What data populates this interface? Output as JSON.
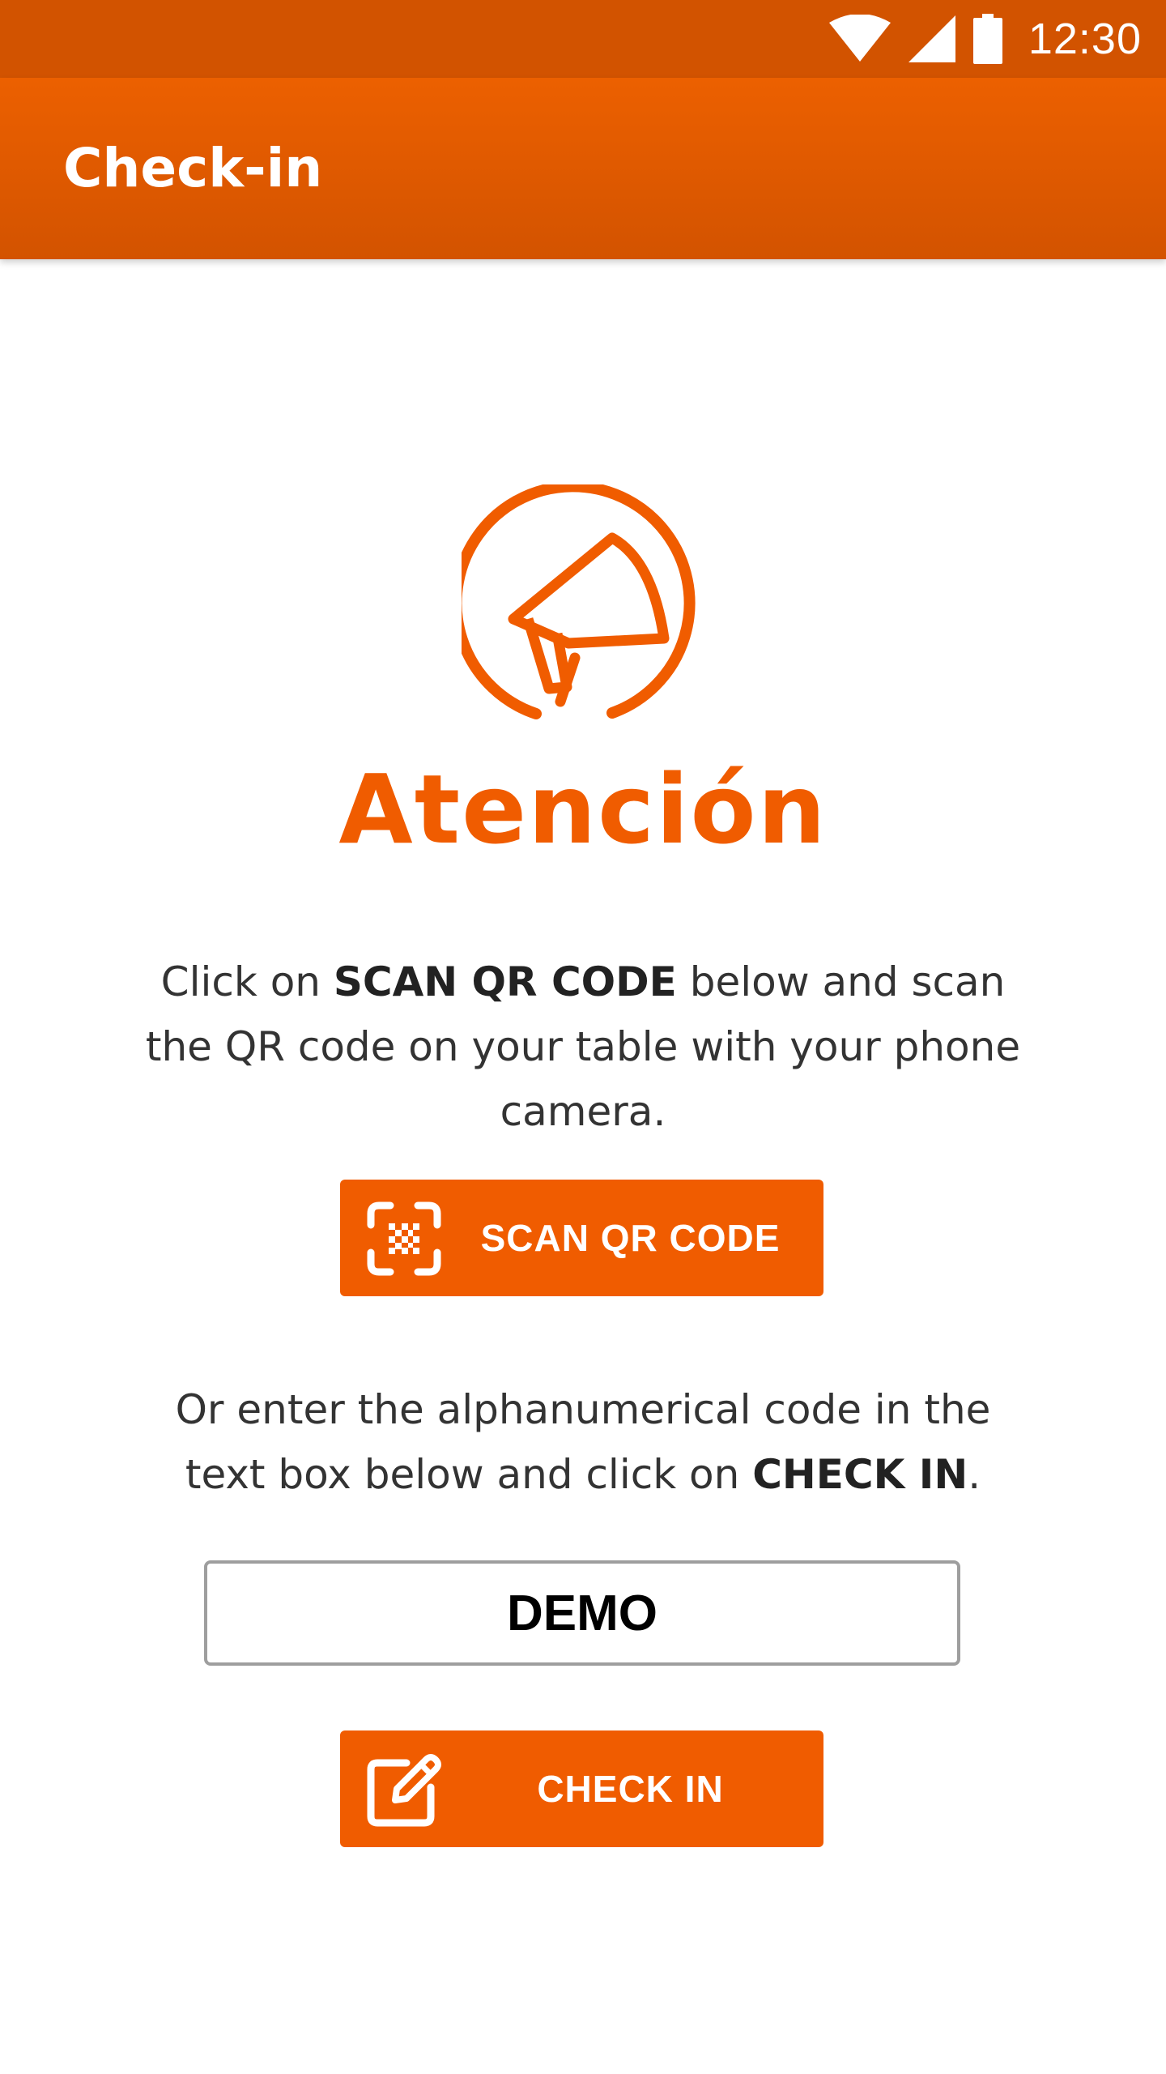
{
  "status_bar": {
    "time": "12:30",
    "icons": [
      "wifi-icon",
      "cell-signal-icon",
      "battery-icon"
    ]
  },
  "app_bar": {
    "title": "Check-in"
  },
  "brand": {
    "name": "Atención",
    "logo_icon": "megaphone-logo-icon",
    "color": "#f05c00"
  },
  "scan_section": {
    "text_before": "Click on ",
    "text_bold": "SCAN QR CODE",
    "text_after": " below and scan the QR code on your table with your phone camera.",
    "button_label": "SCAN QR CODE",
    "button_icon": "qr-scan-icon"
  },
  "code_section": {
    "text_before": "Or enter the alphanumerical code in the text box below and click on ",
    "text_bold": "CHECK IN",
    "text_after": ".",
    "input_value": "DEMO",
    "button_label": "CHECK IN",
    "button_icon": "edit-icon"
  },
  "colors": {
    "status_bar": "#d25300",
    "app_bar": "#e65c00",
    "accent": "#f05c00"
  }
}
